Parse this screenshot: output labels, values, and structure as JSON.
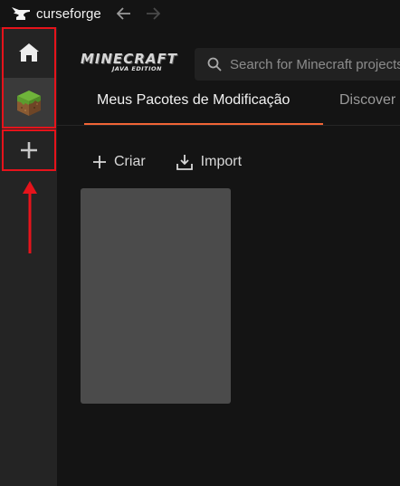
{
  "titlebar": {
    "app_name": "curseforge",
    "logo_icon": "curseforge-anvil-icon",
    "back_icon": "arrow-left-icon",
    "forward_icon": "arrow-right-icon"
  },
  "rail": {
    "items": [
      {
        "name": "home",
        "icon": "home-icon",
        "selected": false
      },
      {
        "name": "minecraft",
        "icon": "minecraft-grass-block-icon",
        "selected": true
      },
      {
        "name": "add-game",
        "icon": "plus-icon",
        "selected": false
      }
    ],
    "annotation": {
      "color": "#e6131b",
      "icon": "red-arrow-up-icon"
    }
  },
  "game_header": {
    "logo_title": "MINECRAFT",
    "logo_subtitle": "JAVA EDITION"
  },
  "search": {
    "placeholder": "Search for Minecraft projects"
  },
  "tabs": [
    {
      "label": "Meus Pacotes de Modificação",
      "active": true
    },
    {
      "label": "Discover",
      "active": false
    }
  ],
  "actions": {
    "create_label": "Criar",
    "import_label": "Import"
  },
  "colors": {
    "accent": "#f16436",
    "background": "#141414",
    "rail": "#242424",
    "card": "#4b4b4b"
  }
}
